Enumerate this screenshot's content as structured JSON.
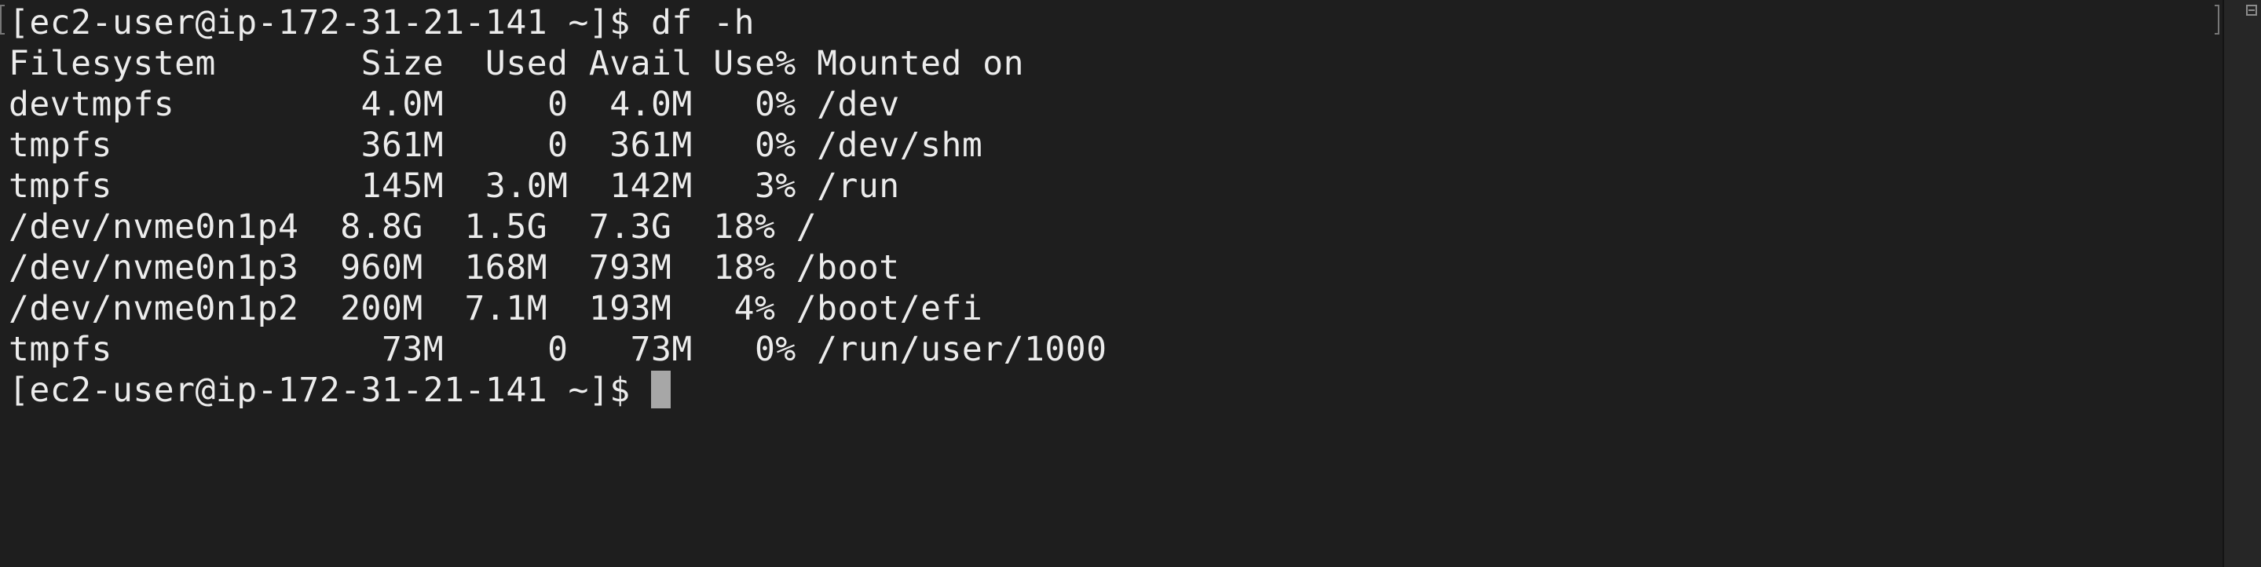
{
  "terminal": {
    "lines": [
      "[ec2-user@ip-172-31-21-141 ~]$ df -h",
      "Filesystem       Size  Used Avail Use% Mounted on",
      "devtmpfs         4.0M     0  4.0M   0% /dev",
      "tmpfs            361M     0  361M   0% /dev/shm",
      "tmpfs            145M  3.0M  142M   3% /run",
      "/dev/nvme0n1p4  8.8G  1.5G  7.3G  18% /",
      "/dev/nvme0n1p3  960M  168M  793M  18% /boot",
      "/dev/nvme0n1p2  200M  7.1M  193M   4% /boot/efi",
      "tmpfs             73M     0   73M   0% /run/user/1000"
    ],
    "prompt": "[ec2-user@ip-172-31-21-141 ~]$"
  },
  "colors": {
    "background": "#1e1e1e",
    "text": "#ececec",
    "cursor": "#a7a7a7"
  }
}
